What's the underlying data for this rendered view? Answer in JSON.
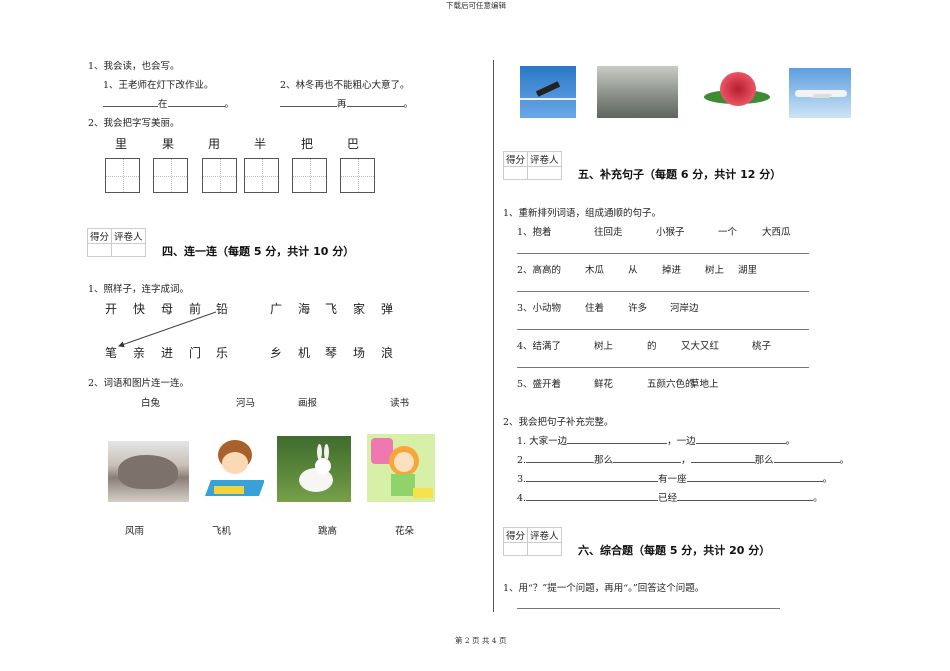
{
  "header": "下载后可任意编辑",
  "footer": "第 2 页 共 4 页",
  "left": {
    "q1": "1、我会读，也会写。",
    "s1": "1、王老师在灯下改作业。",
    "s2": "2、林冬再也不能粗心大意了。",
    "w1": "在",
    "w2": "再",
    "dot": "。",
    "q2": "2、我会把字写美丽。",
    "chars": [
      "里",
      "果",
      "用",
      "半",
      "把",
      "巴"
    ],
    "score_labels": [
      "得分",
      "评卷人"
    ],
    "section4": "四、连一连（每题 5 分，共计 10 分）",
    "q3": "1、照样子，连字成词。",
    "row1": [
      "开",
      "快",
      "母",
      "前",
      "铅",
      "广",
      "海",
      "飞",
      "家",
      "弹"
    ],
    "row2": [
      "笔",
      "亲",
      "进",
      "门",
      "乐",
      "乡",
      "机",
      "琴",
      "场",
      "浪"
    ],
    "q4": "2、词语和图片连一连。",
    "top_words": [
      "白兔",
      "河马",
      "画报",
      "读书"
    ],
    "bottom_words": [
      "风雨",
      "飞机",
      "跳高",
      "花朵"
    ]
  },
  "right": {
    "section5": "五、补充句子（每题 6 分，共计 12 分）",
    "q1": "1、重新排列词语，组成通顺的句子。",
    "rows": [
      [
        "1、抱着",
        "往回走",
        "小猴子",
        "一个",
        "大西瓜"
      ],
      [
        "2、高高的",
        "木瓜",
        "从",
        "掉进",
        "树上",
        "湖里"
      ],
      [
        "3、小动物",
        "住着",
        "许多",
        "河岸边"
      ],
      [
        "4、结满了",
        "树上",
        "的",
        "又大又红",
        "桃子"
      ],
      [
        "5、盛开着",
        "鲜花",
        "五颜六色的",
        "草地上"
      ]
    ],
    "q2": "2、我会把句子补充完整。",
    "c1": [
      "1. 大家一边",
      "，一边",
      "。"
    ],
    "c2": [
      "2.",
      "那么",
      "，",
      "那么",
      "。"
    ],
    "c3": [
      "3.",
      "有一座",
      "。"
    ],
    "c4": [
      "4.",
      "已经",
      "。"
    ],
    "section6": "六、综合题（每题 5 分，共计 20 分）",
    "q3": "1、用“？”提一个问题，再用“。”回答这个问题。"
  }
}
